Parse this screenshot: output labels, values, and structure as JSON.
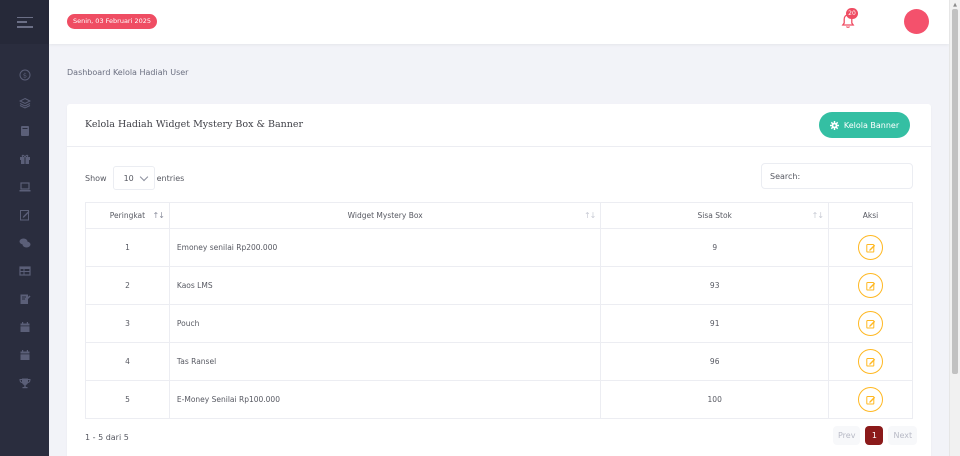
{
  "header": {
    "date": "Senin, 03 Februari 2025",
    "notification_count": "20"
  },
  "breadcrumb": "Dashboard Kelola Hadiah User",
  "card": {
    "title": "Kelola Hadiah Widget Mystery Box & Banner",
    "banner_button": "Kelola Banner"
  },
  "table_controls": {
    "show_label": "Show",
    "entries_value": "10",
    "entries_label": "entries",
    "search_placeholder": "Search:"
  },
  "table": {
    "headers": [
      "Peringkat",
      "Widget Mystery Box",
      "Sisa Stok",
      "Aksi"
    ],
    "rows": [
      {
        "rank": "1",
        "name": "Emoney senilai Rp200.000",
        "stock": "9"
      },
      {
        "rank": "2",
        "name": "Kaos LMS",
        "stock": "93"
      },
      {
        "rank": "3",
        "name": "Pouch",
        "stock": "91"
      },
      {
        "rank": "4",
        "name": "Tas Ransel",
        "stock": "96"
      },
      {
        "rank": "5",
        "name": "E-Money Senilai Rp100.000",
        "stock": "100"
      }
    ]
  },
  "footer": {
    "info": "1 - 5 dari 5",
    "prev": "Prev",
    "page": "1",
    "next": "Next"
  },
  "icons": {
    "sidebar": [
      "dollar-icon",
      "layers-icon",
      "book-icon",
      "gift-icon",
      "laptop-icon",
      "edit-note-icon",
      "chat-icon",
      "table-icon",
      "checklist-icon",
      "calendar-icon",
      "calendar-icon",
      "trophy-icon"
    ],
    "edit": "edit-icon",
    "settings": "gear-icon",
    "bell": "bell-icon"
  },
  "colors": {
    "sidebar": "#2a2d3e",
    "badge": "#ef4d63",
    "banner_button": "#34bfa3",
    "edit_button": "#ffb822",
    "current_page": "#8b1a1a"
  }
}
